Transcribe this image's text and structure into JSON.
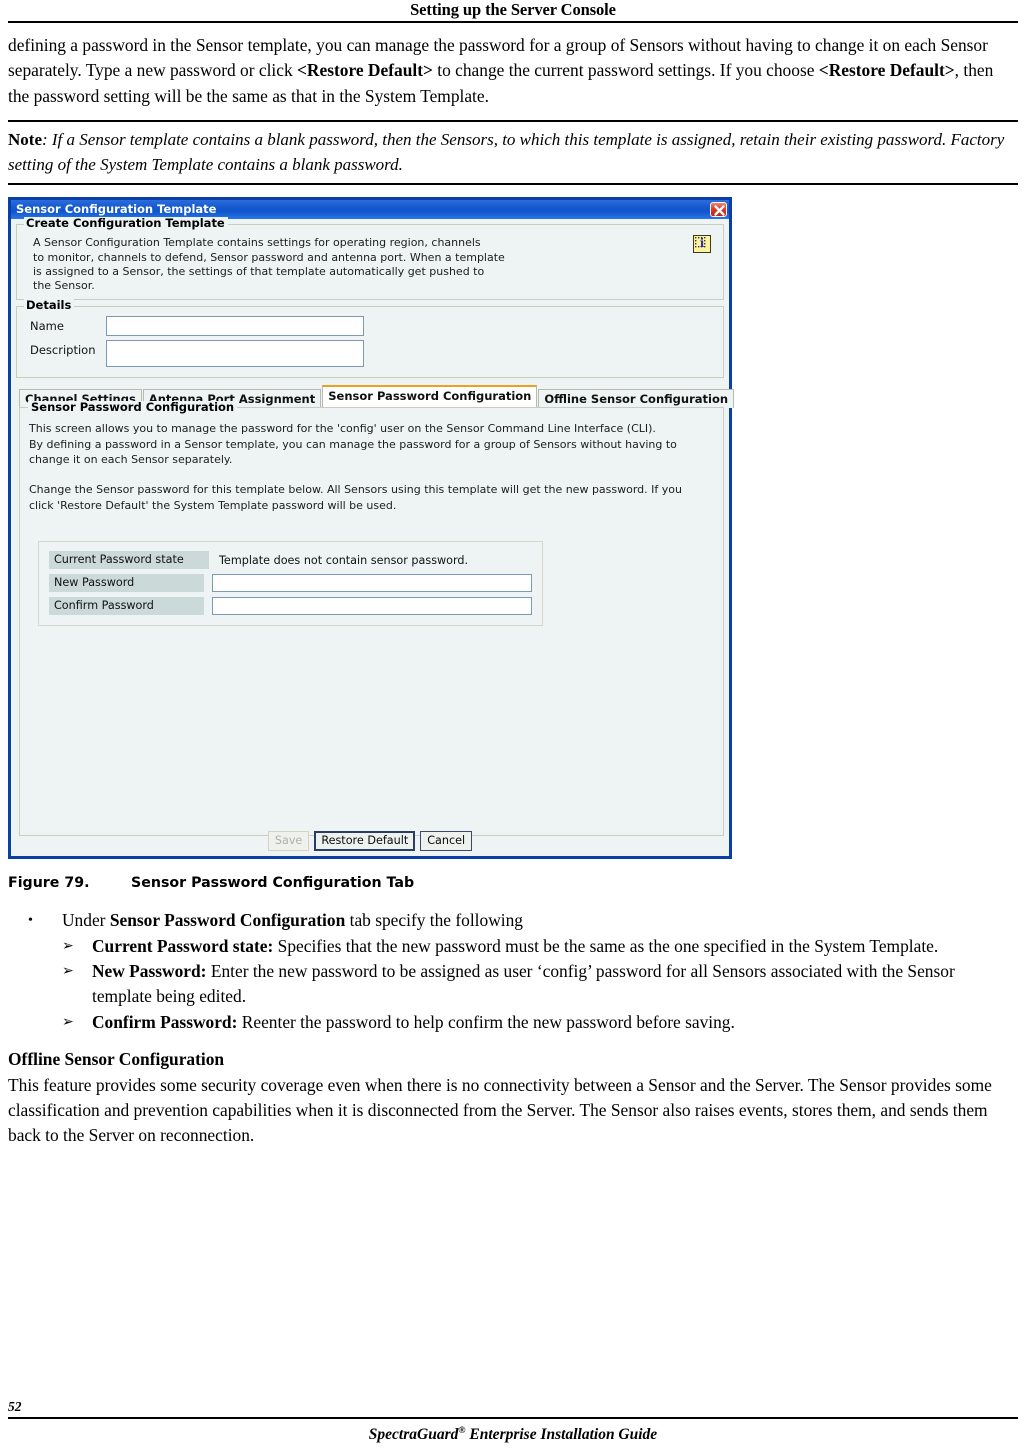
{
  "header": {
    "running_head": "Setting up the Server Console"
  },
  "intro": {
    "paragraph": "defining a password in the Sensor template, you can manage the password for a group of Sensors without having to change it on each Sensor separately. Type a new password or click <Restore Default> to change the current password settings. If you choose <Restore Default>, then the password setting will be the same as that in the System Template.",
    "bold_terms": [
      "<Restore Default>",
      "<Restore Default>"
    ]
  },
  "note": {
    "lead": "Note",
    "text": ": If a Sensor template contains a blank password, then the Sensors, to which this template is assigned, retain their existing password. Factory setting of the System Template contains a blank password."
  },
  "dialog": {
    "title": "Sensor Configuration Template",
    "close_icon": "close-icon",
    "create_group": {
      "title": "Create Configuration Template",
      "description": "A Sensor Configuration Template contains settings for operating region, channels\nto monitor, channels to defend, Sensor password and antenna port. When a template\nis assigned to a Sensor, the settings of that template automatically get pushed to\nthe Sensor.",
      "info_icon": "info-icon"
    },
    "details_group": {
      "title": "Details",
      "name_label": "Name",
      "name_value": "",
      "description_label": "Description",
      "description_value": ""
    },
    "tabs": [
      {
        "label": "Channel Settings",
        "active": false
      },
      {
        "label": "Antenna Port Assignment",
        "active": false
      },
      {
        "label": "Sensor Password Configuration",
        "active": true
      },
      {
        "label": "Offline Sensor Configuration",
        "active": false
      }
    ],
    "panel": {
      "title": "Sensor Password Configuration",
      "description": "This screen allows you to manage the password for the 'config' user on the Sensor Command Line Interface (CLI).\nBy defining a password in a Sensor template, you can manage the password for a group of Sensors without having to\nchange it on each Sensor separately.\n\nChange the Sensor password for this template below. All Sensors using this template will get the new password. If you\nclick 'Restore Default' the System Template password will be used.",
      "rows": {
        "current_state_label": "Current Password state",
        "current_state_value": "Template does not contain sensor password.",
        "new_password_label": "New Password",
        "new_password_value": "",
        "confirm_password_label": "Confirm Password",
        "confirm_password_value": ""
      }
    },
    "buttons": {
      "save": "Save",
      "restore_default": "Restore Default",
      "cancel": "Cancel"
    },
    "colors": {
      "titlebar": "#1659cf",
      "close_red": "#c12010",
      "active_tab_accent": "#f0a021",
      "panel_bg": "#eef4f4",
      "label_bg": "#ccd9d9",
      "field_border": "#7d98b3"
    }
  },
  "figure": {
    "number": "Figure  79.",
    "caption": "Sensor Password Configuration Tab"
  },
  "bullets": {
    "lead_plain_1": "Under ",
    "lead_bold": "Sensor Password Configuration",
    "lead_plain_2": " tab specify the following",
    "items": [
      {
        "term": "Current Password state:",
        "text": " Specifies that the new password must be the same as the one specified in the System Template."
      },
      {
        "term": "New Password:",
        "text": " Enter the new password to be assigned as user ‘config’ password for all Sensors associated with the Sensor template being edited."
      },
      {
        "term": "Confirm Password:",
        "text": " Reenter the password to help confirm the new password before saving."
      }
    ],
    "bullet_glyph": "•",
    "sub_glyph": "➢"
  },
  "offline_section": {
    "heading": "Offline Sensor Configuration",
    "paragraph": "This feature provides some security coverage even when there is no connectivity between a Sensor and the Server. The Sensor provides some classification and prevention capabilities when it is disconnected from the Server. The Sensor also raises events, stores them, and sends them back to the Server on reconnection."
  },
  "footer": {
    "page_number": "52",
    "guide_pre": "SpectraGuard",
    "guide_sup": "®",
    "guide_post": " Enterprise Installation Guide"
  }
}
